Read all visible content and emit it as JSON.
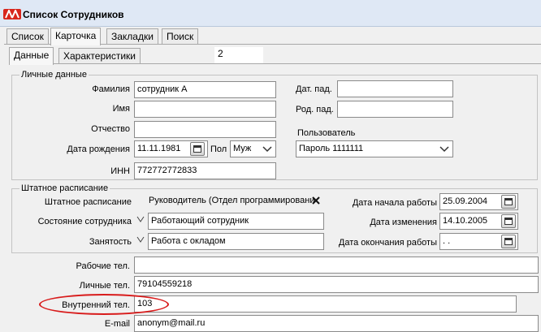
{
  "window": {
    "title": "Список Сотрудников"
  },
  "tabs": [
    "Список",
    "Карточка",
    "Закладки",
    "Поиск"
  ],
  "subtabs": [
    "Данные",
    "Характеристики"
  ],
  "record_counter": "2",
  "personal": {
    "legend": "Личные данные",
    "surname_label": "Фамилия",
    "surname": "сотрудник А",
    "name_label": "Имя",
    "name": "",
    "patronymic_label": "Отчество",
    "patronymic": "",
    "birthdate_label": "Дата рождения",
    "birthdate": "11.11.1981",
    "sex_label": "Пол",
    "sex": "Муж",
    "dat_label": "Дат. пад.",
    "dat": "",
    "rod_label": "Род. пад.",
    "rod": "",
    "user_label": "Пользователь",
    "user": "Пароль 1111111",
    "inn_label": "ИНН",
    "inn": "772772772833"
  },
  "staff": {
    "legend": "Штатное расписание",
    "position_label": "Штатное расписание",
    "position": "Руководитель (Отдел программировани",
    "state_label": "Состояние сотрудника",
    "state": "Работающий сотрудник",
    "employment_label": "Занятость",
    "employment": "Работа с окладом",
    "start_label": "Дата начала работы",
    "start": "25.09.2004",
    "change_label": "Дата изменения",
    "change": "14.10.2005",
    "end_label": "Дата окончания работы",
    "end": " .  ."
  },
  "contacts": {
    "work_phone_label": "Рабочие тел.",
    "work_phone": "",
    "personal_phone_label": "Личные тел.",
    "personal_phone": "79104559218",
    "internal_phone_label": "Внутренний тел.",
    "internal_phone": "103",
    "email_label": "E-mail",
    "email": "anonym@mail.ru"
  },
  "colors": {
    "highlight": "#d81b1b",
    "logo": "#d8261c",
    "titlebar": "#dfe8f5"
  },
  "icons": [
    "app-logo-icon",
    "calendar-icon",
    "dropdown-arrow-icon",
    "chevron-icon",
    "clear-icon"
  ]
}
